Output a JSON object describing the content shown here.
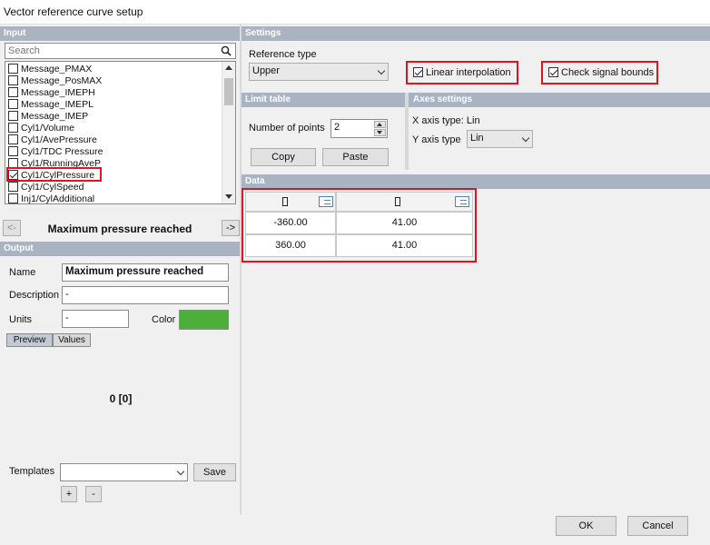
{
  "window": {
    "title": "Vector reference curve setup"
  },
  "input": {
    "header": "Input",
    "search_placeholder": "Search",
    "items": [
      {
        "label": "Message_PMAX",
        "checked": false
      },
      {
        "label": "Message_PosMAX",
        "checked": false
      },
      {
        "label": "Message_IMEPH",
        "checked": false
      },
      {
        "label": "Message_IMEPL",
        "checked": false
      },
      {
        "label": "Message_IMEP",
        "checked": false
      },
      {
        "label": "Cyl1/Volume",
        "checked": false
      },
      {
        "label": "Cyl1/AvePressure",
        "checked": false
      },
      {
        "label": "Cyl1/TDC Pressure",
        "checked": false
      },
      {
        "label": "Cyl1/RunningAveP",
        "checked": false
      },
      {
        "label": "Cyl1/CylPressure",
        "checked": true
      },
      {
        "label": "Cyl1/CylSpeed",
        "checked": false
      },
      {
        "label": "Inj1/CylAdditional",
        "checked": false
      }
    ],
    "prev_button": "<-",
    "next_button": "->",
    "selected_name": "Maximum pressure reached"
  },
  "output": {
    "header": "Output",
    "name_label": "Name",
    "name_value": "Maximum pressure reached",
    "description_label": "Description",
    "description_value": "-",
    "units_label": "Units",
    "units_value": "-",
    "color_label": "Color",
    "color_value": "#4caf3c",
    "tabs": [
      "Preview",
      "Values"
    ],
    "preview_text": "0 [0]",
    "templates_label": "Templates",
    "templates_value": "",
    "save_button": "Save",
    "add_button": "+",
    "remove_button": "-"
  },
  "settings": {
    "header": "Settings",
    "reference_type_label": "Reference type",
    "reference_type_value": "Upper",
    "linear_interpolation_label": "Linear interpolation",
    "linear_interpolation_checked": true,
    "check_signal_bounds_label": "Check signal bounds",
    "check_signal_bounds_checked": true
  },
  "limit_table": {
    "header": "Limit table",
    "points_label": "Number of points",
    "points_value": "2",
    "copy_button": "Copy",
    "paste_button": "Paste"
  },
  "axes": {
    "header": "Axes settings",
    "x_axis_type_text": "X axis type: Lin",
    "y_axis_type_label": "Y axis type",
    "y_axis_type_value": "Lin"
  },
  "data": {
    "header": "Data",
    "rows": [
      [
        "-360.00",
        "41.00"
      ],
      [
        "360.00",
        "41.00"
      ]
    ]
  },
  "footer": {
    "ok_button": "OK",
    "cancel_button": "Cancel"
  },
  "colors": {
    "header_bg": "#a9b3c2",
    "highlight": "#e0141e"
  }
}
